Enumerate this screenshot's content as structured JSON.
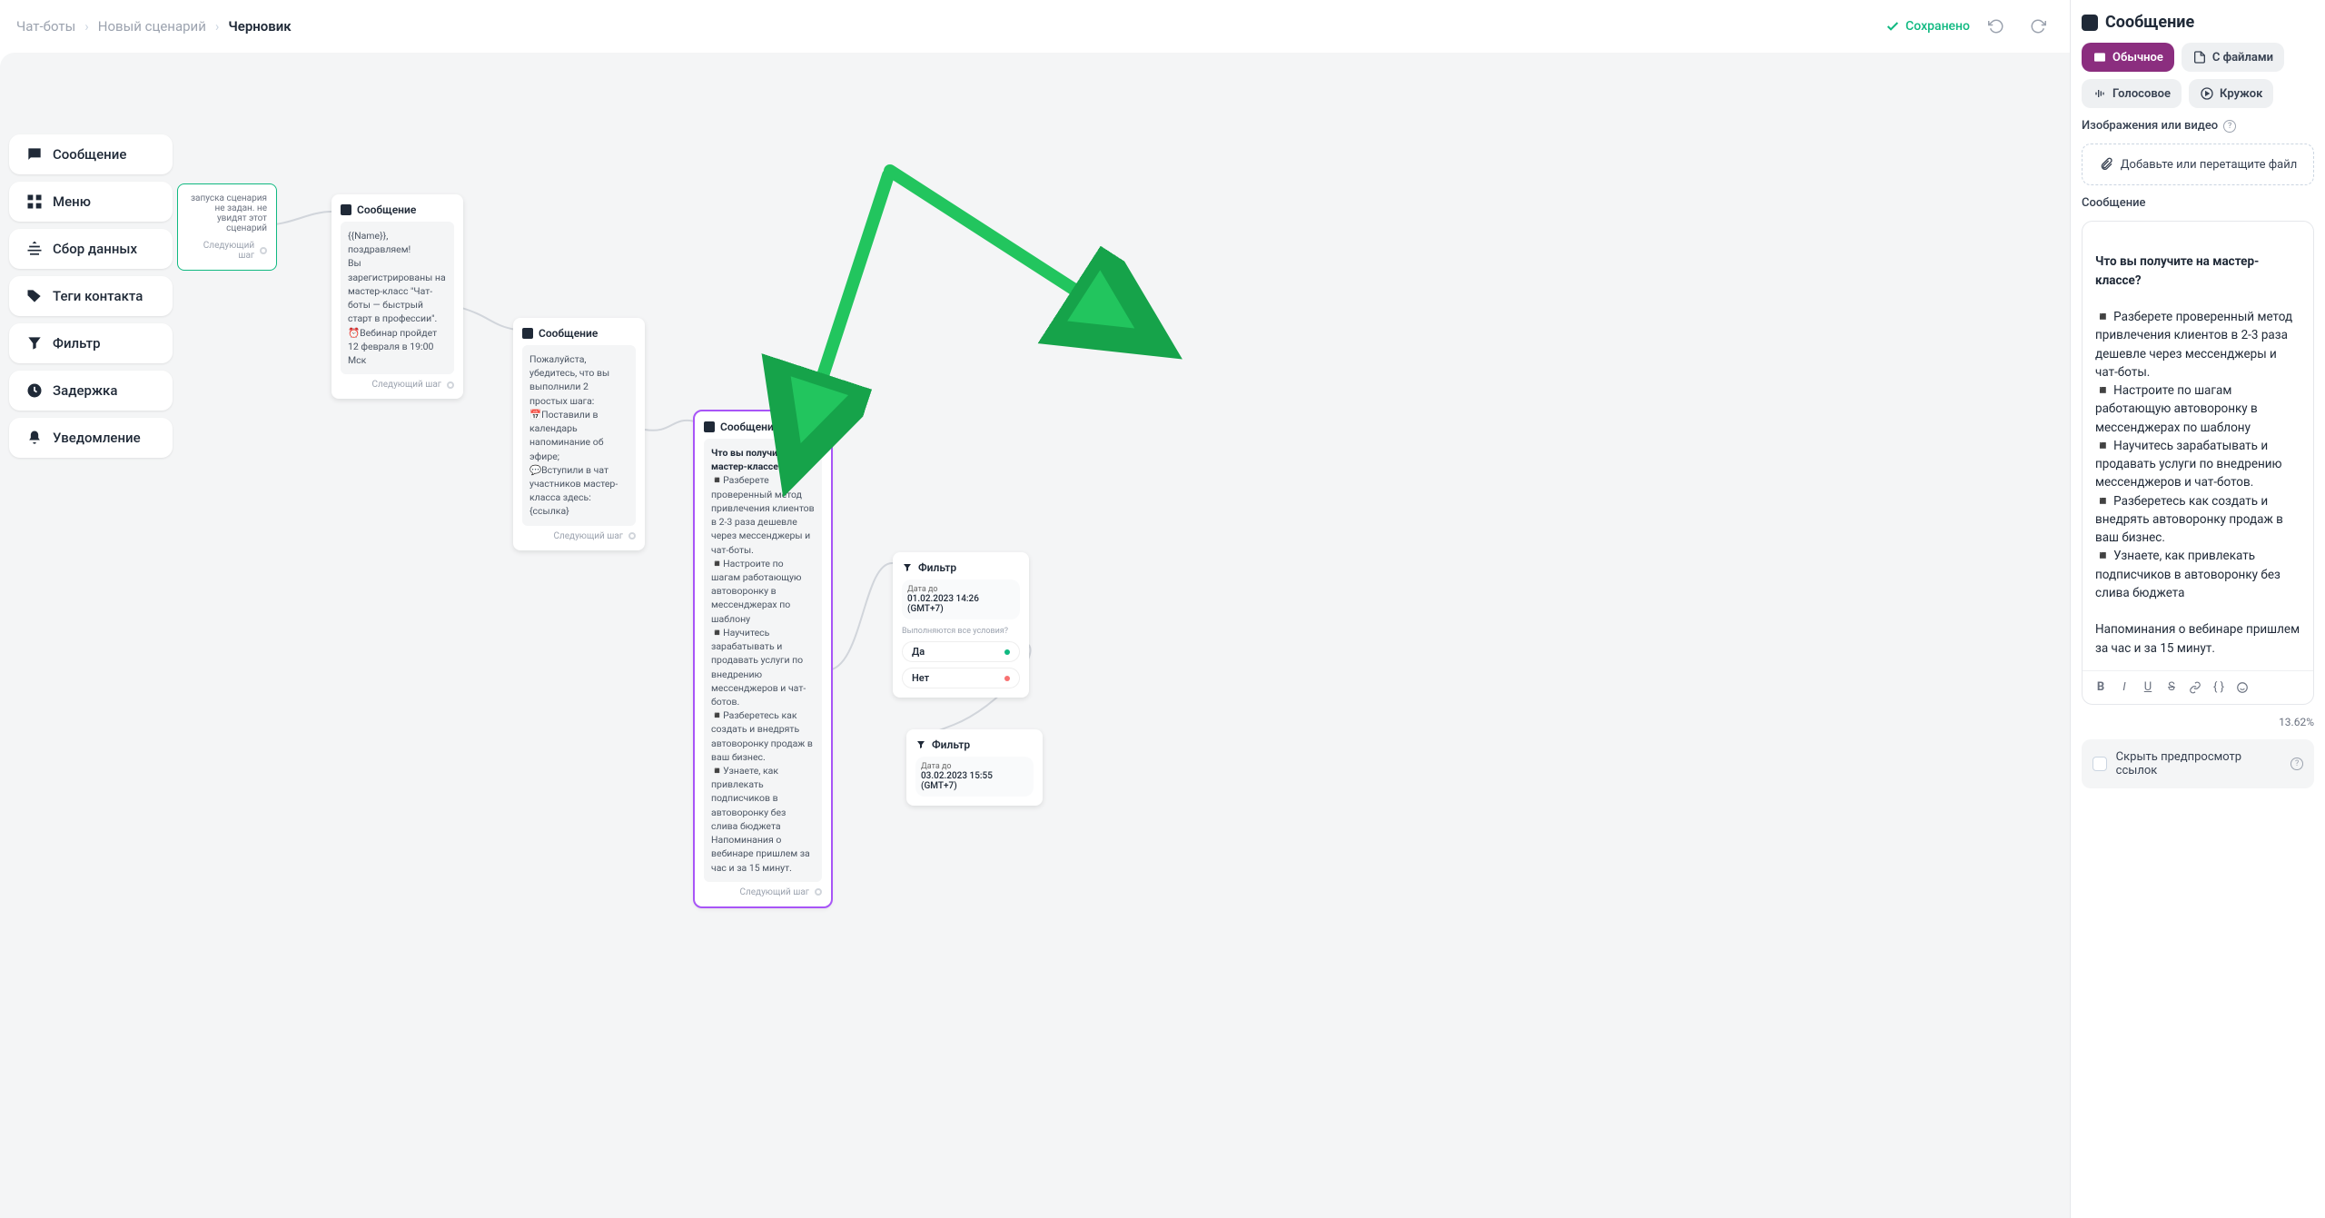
{
  "breadcrumbs": {
    "chatbots": "Чат-боты",
    "new_scenario": "Новый сценарий",
    "draft": "Черновик"
  },
  "saved_label": "Сохранено",
  "blocks": {
    "message": "Сообщение",
    "menu": "Меню",
    "collect": "Сбор данных",
    "tags": "Теги контакта",
    "filter": "Фильтр",
    "delay": "Задержка",
    "notify": "Уведомление"
  },
  "canvas": {
    "trigger": {
      "text": "запуска сценария не задан.\nне увидят этот сценарий",
      "next": "Следующий шаг"
    },
    "card1": {
      "title": "Сообщение",
      "body": "{{Name}}, поздравляем!\nВы зарегистрированы на мастер-класс \"Чат-боты — быстрый старт в профессии\".\n⏰Вебинар пройдет 12 февраля в 19:00 Мск",
      "next": "Следующий шаг"
    },
    "card2": {
      "title": "Сообщение",
      "body": "Пожалуйста, убедитесь, что вы выполнили 2 простых шага:\n📅Поставили в календарь напоминание об эфире;\n💬Вступили в чат участников мастер-класса здесь: {ссылка}",
      "next": "Следующий шаг"
    },
    "card3": {
      "title": "Сообщение",
      "body_heading": "Что вы получите на мастер-классе?",
      "body": "◾Разберете проверенный метод привлечения клиентов в 2-3 раза дешевле через мессенджеры и чат-боты.\n◾Настроите по шагам работающую автоворонку в мессенджерах по шаблону\n◾Научитесь зарабатывать и продавать услуги по внедрению мессенджеров и чат-ботов.\n◾Разберетесь как создать и внедрять автоворонку продаж в ваш бизнес.\n◾Узнаете, как привлекать подписчиков в автоворонку без слива бюджета\nНапоминания о вебинаре пришлем за час и за 15 минут.",
      "next": "Следующий шаг"
    },
    "filter1": {
      "title": "Фильтр",
      "date_label": "Дата до",
      "date": "01.02.2023 14:26 (GMT+7)",
      "question": "Выполняются все условия?",
      "yes": "Да",
      "no": "Нет"
    },
    "filter2": {
      "title": "Фильтр",
      "date_label": "Дата до",
      "date": "03.02.2023 15:55 (GMT+7)"
    }
  },
  "panel": {
    "title": "Сообщение",
    "tabs": {
      "regular": "Обычное",
      "files": "С файлами",
      "voice": "Голосовое",
      "circle": "Кружок"
    },
    "media_label": "Изображения или видео",
    "uploader": "Добавьте или перетащите файл",
    "message_label": "Сообщение",
    "editor_heading": "Что вы получите на мастер-классе?",
    "editor_body": "◾ Разберете проверенный метод привлечения клиентов в 2-3 раза дешевле через мессенджеры и чат-боты.\n◾ Настроите по шагам работающую автоворонку в мессенджерах по шаблону\n◾ Научитесь зарабатывать и продавать услуги по внедрению мессенджеров и чат-ботов.\n◾ Разберетесь как создать и внедрять автоворонку продаж в ваш бизнес.\n◾ Узнаете, как привлекать подписчиков в автоворонку без слива бюджета\n\nНапоминания о вебинаре пришлем за час и за 15 минут.",
    "percent": "13.62%",
    "hide_preview": "Скрыть предпросмотр ссылок"
  }
}
